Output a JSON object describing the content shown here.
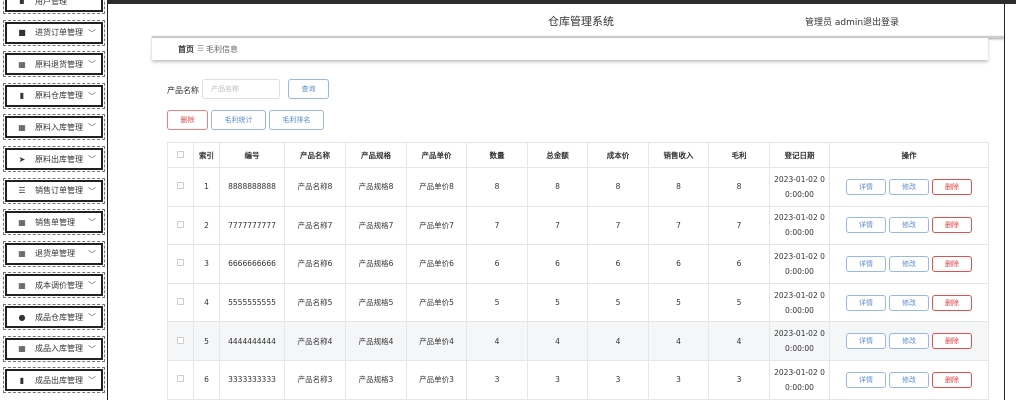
{
  "header": {
    "title": "仓库管理系统",
    "user": "管理员 admin",
    "logout": "退出登录"
  },
  "sidebar": {
    "items": [
      {
        "label": "用户管理",
        "icon": "user-manage-icon",
        "glyph": "▪"
      },
      {
        "label": "进货订单管理",
        "icon": "clipboard-icon",
        "glyph": "■"
      },
      {
        "label": "原料退货管理",
        "icon": "grid-icon",
        "glyph": "▦"
      },
      {
        "label": "原料仓库管理",
        "icon": "bar-chart-icon",
        "glyph": "▮"
      },
      {
        "label": "原料入库管理",
        "icon": "grid-icon",
        "glyph": "▦"
      },
      {
        "label": "原料出库管理",
        "icon": "send-icon",
        "glyph": "➤"
      },
      {
        "label": "销售订单管理",
        "icon": "list-icon",
        "glyph": "☰"
      },
      {
        "label": "销售单管理",
        "icon": "grid-icon",
        "glyph": "▦"
      },
      {
        "label": "退货单管理",
        "icon": "grid-icon",
        "glyph": "▦"
      },
      {
        "label": "成本调价管理",
        "icon": "grid-icon",
        "glyph": "▦"
      },
      {
        "label": "成品仓库管理",
        "icon": "user-icon",
        "glyph": "●"
      },
      {
        "label": "成品入库管理",
        "icon": "grid-icon",
        "glyph": "▦"
      },
      {
        "label": "成品出库管理",
        "icon": "bar-chart-icon",
        "glyph": "▮"
      }
    ]
  },
  "breadcrumb": {
    "home": "首页",
    "sep": "☰",
    "current": "毛利信息"
  },
  "search": {
    "label": "产品名称",
    "placeholder": "产品名称",
    "query": "查询"
  },
  "actions": {
    "delete": "删除",
    "stats": "毛利统计",
    "rank": "毛利排名"
  },
  "table": {
    "columns": [
      "",
      "索引",
      "编号",
      "产品名称",
      "产品规格",
      "产品单价",
      "数量",
      "总金额",
      "成本价",
      "销售收入",
      "毛利",
      "登记日期",
      "操作"
    ],
    "row_buttons": {
      "detail": "详情",
      "edit": "修改",
      "delete": "删除"
    },
    "rows": [
      {
        "index": "1",
        "code": "8888888888",
        "name": "产品名称8",
        "spec": "产品规格8",
        "price": "产品单价8",
        "qty": "8",
        "total": "8",
        "cost": "8",
        "revenue": "8",
        "profit": "8",
        "date_line1": "2023-01-02 0",
        "date_line2": "0:00:00"
      },
      {
        "index": "2",
        "code": "7777777777",
        "name": "产品名称7",
        "spec": "产品规格7",
        "price": "产品单价7",
        "qty": "7",
        "total": "7",
        "cost": "7",
        "revenue": "7",
        "profit": "7",
        "date_line1": "2023-01-02 0",
        "date_line2": "0:00:00"
      },
      {
        "index": "3",
        "code": "6666666666",
        "name": "产品名称6",
        "spec": "产品规格6",
        "price": "产品单价6",
        "qty": "6",
        "total": "6",
        "cost": "6",
        "revenue": "6",
        "profit": "6",
        "date_line1": "2023-01-02 0",
        "date_line2": "0:00:00"
      },
      {
        "index": "4",
        "code": "5555555555",
        "name": "产品名称5",
        "spec": "产品规格5",
        "price": "产品单价5",
        "qty": "5",
        "total": "5",
        "cost": "5",
        "revenue": "5",
        "profit": "5",
        "date_line1": "2023-01-02 0",
        "date_line2": "0:00:00"
      },
      {
        "index": "5",
        "code": "4444444444",
        "name": "产品名称4",
        "spec": "产品规格4",
        "price": "产品单价4",
        "qty": "4",
        "total": "4",
        "cost": "4",
        "revenue": "4",
        "profit": "4",
        "date_line1": "2023-01-02 0",
        "date_line2": "0:00:00"
      },
      {
        "index": "6",
        "code": "3333333333",
        "name": "产品名称3",
        "spec": "产品规格3",
        "price": "产品单价3",
        "qty": "3",
        "total": "3",
        "cost": "3",
        "revenue": "3",
        "profit": "3",
        "date_line1": "2023-01-02 0",
        "date_line2": "0:00:00"
      }
    ]
  }
}
